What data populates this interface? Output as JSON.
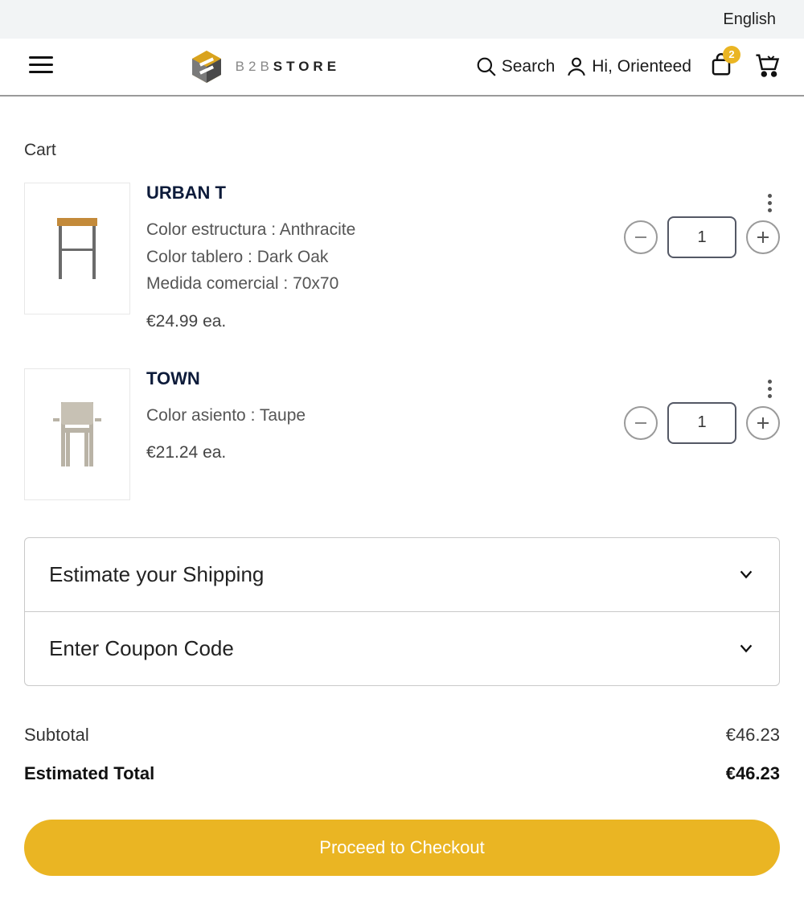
{
  "topbar": {
    "language": "English"
  },
  "header": {
    "logo_prefix": "B2B",
    "logo_suffix": "STORE",
    "search_label": "Search",
    "greeting": "Hi, Orienteed",
    "bag_badge": "2"
  },
  "page": {
    "title": "Cart",
    "currency": "€",
    "items": [
      {
        "name": "URBAN T",
        "attrs": [
          "Color estructura : Anthracite",
          "Color tablero : Dark Oak",
          "Medida comercial : 70x70"
        ],
        "price_each": "€24.99 ea.",
        "qty": "1"
      },
      {
        "name": "TOWN",
        "attrs": [
          "Color asiento : Taupe"
        ],
        "price_each": "€21.24 ea.",
        "qty": "1"
      }
    ],
    "accordion": {
      "shipping": "Estimate your Shipping",
      "coupon": "Enter Coupon Code"
    },
    "totals": {
      "subtotal_label": "Subtotal",
      "subtotal_value": "€46.23",
      "est_total_label": "Estimated Total",
      "est_total_value": "€46.23"
    },
    "checkout_label": "Proceed to Checkout"
  },
  "colors": {
    "accent": "#eab523"
  }
}
